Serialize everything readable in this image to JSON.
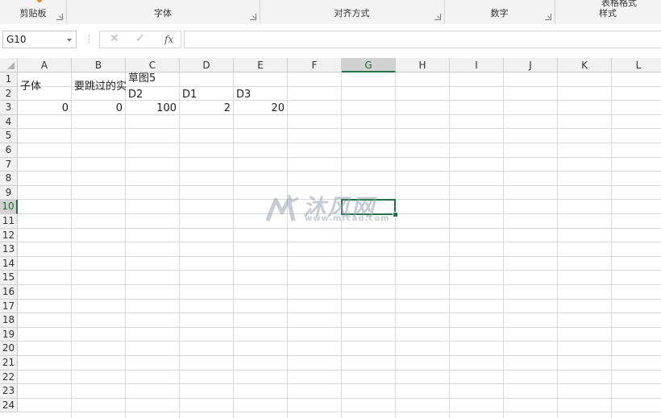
{
  "ribbon": {
    "groups": [
      {
        "label": "剪贴板"
      },
      {
        "label": "字体"
      },
      {
        "label": "对齐方式"
      },
      {
        "label": "数字"
      },
      {
        "label": "样式"
      }
    ],
    "top_cut_text": "表格格式"
  },
  "formula_bar": {
    "name_box": "G10",
    "cancel_icon": "✕",
    "enter_icon": "✓",
    "fx_label": "fx",
    "formula": ""
  },
  "grid": {
    "columns": [
      "A",
      "B",
      "C",
      "D",
      "E",
      "F",
      "G",
      "H",
      "I",
      "J",
      "K",
      "L"
    ],
    "rows": [
      "1",
      "2",
      "3",
      "4",
      "5",
      "6",
      "7",
      "8",
      "9",
      "10",
      "11",
      "12",
      "13",
      "14",
      "15",
      "16",
      "17",
      "18",
      "19",
      "20",
      "21",
      "22",
      "23",
      "24"
    ],
    "selected_cell": "G10",
    "cells": {
      "A1": "子体",
      "B1": "要跳过的实",
      "C1": "草图5",
      "C2": "D2",
      "D2": "D1",
      "E2": "D3",
      "A3": "0",
      "B3": "0",
      "C3": "100",
      "D3": "2",
      "E3": "20"
    }
  },
  "watermark": {
    "text": "沐风网",
    "url": "www.mfcad.com",
    "color": "#9aa3b2"
  },
  "colors": {
    "accent": "#217346",
    "header_bg": "#f1f1f1",
    "gridline": "#dadada"
  }
}
